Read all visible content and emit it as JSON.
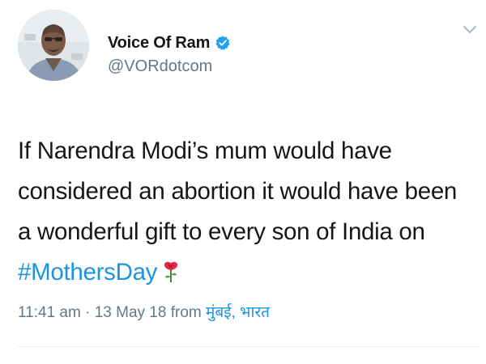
{
  "author": {
    "display_name": "Voice Of Ram",
    "handle": "@VORdotcom",
    "verified": true,
    "verified_color": "#1da1f2",
    "avatar_icon": "profile-photo"
  },
  "tweet": {
    "lines": [
      "If Narendra Modi’s mum would have",
      "considered an abortion it would have been",
      "a wonderful gift to every son of India on"
    ],
    "hashtag": "#MothersDay",
    "emoji_icon": "rose-emoji"
  },
  "meta": {
    "time": "11:41 am",
    "separator": "·",
    "date": "13 May 18",
    "from_label": "from",
    "location": "मुंबई, भारत"
  },
  "colors": {
    "text": "#14171a",
    "secondary": "#657786",
    "link": "#1b95e0"
  }
}
